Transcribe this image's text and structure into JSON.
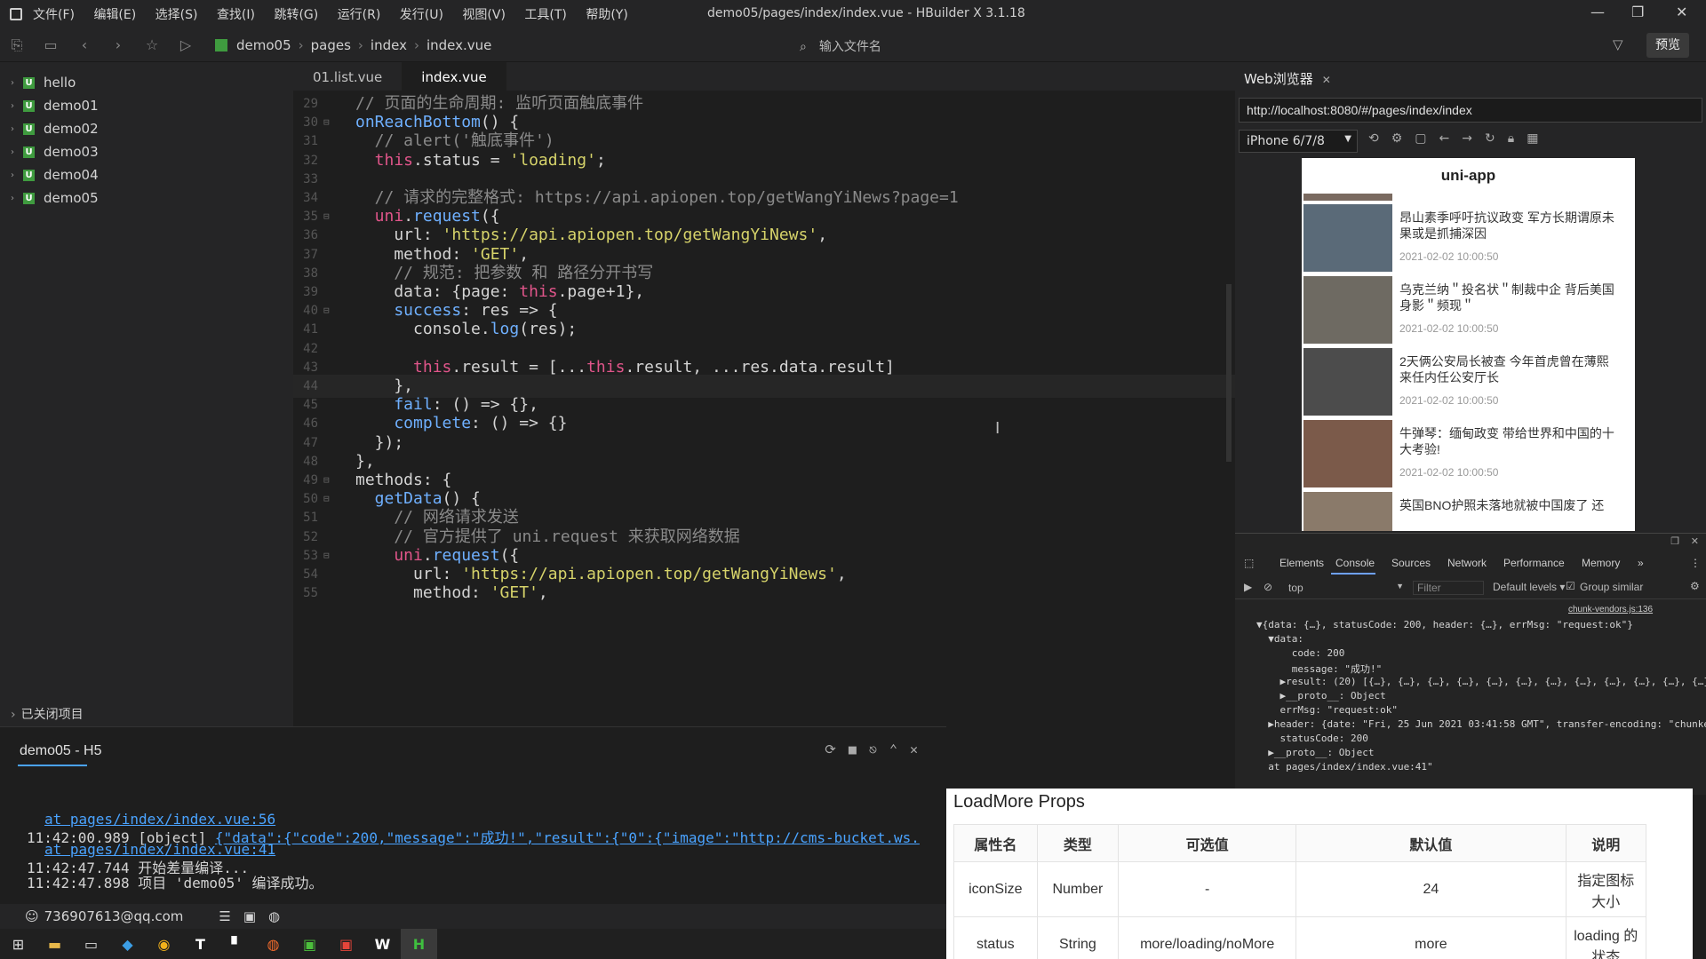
{
  "window": {
    "title": "demo05/pages/index/index.vue - HBuilder X 3.1.18",
    "menu": [
      "文件(F)",
      "编辑(E)",
      "选择(S)",
      "查找(I)",
      "跳转(G)",
      "运行(R)",
      "发行(U)",
      "视图(V)",
      "工具(T)",
      "帮助(Y)"
    ],
    "controls": {
      "minimize": "—",
      "maximize": "❐",
      "close": "✕"
    }
  },
  "toolbar": {
    "breadcrumb": [
      "demo05",
      "pages",
      "index",
      "index.vue"
    ],
    "search_placeholder": "输入文件名",
    "preview_label": "预览"
  },
  "sidebar": {
    "projects": [
      "hello",
      "demo01",
      "demo02",
      "demo03",
      "demo04",
      "demo05"
    ],
    "closed_projects_label": "已关闭项目"
  },
  "editor": {
    "tabs": [
      "01.list.vue",
      "index.vue"
    ],
    "active_tab": "index.vue",
    "lines": [
      {
        "n": "29",
        "fold": "",
        "parts": [
          [
            "cm",
            "// 页面的生命周期: 监听页面触底事件"
          ]
        ]
      },
      {
        "n": "30",
        "fold": "⊟",
        "parts": [
          [
            "fn",
            "onReachBottom"
          ],
          [
            "pl",
            "() {"
          ]
        ]
      },
      {
        "n": "31",
        "fold": "",
        "parts": [
          [
            "cm",
            "  // alert('触底事件')"
          ]
        ]
      },
      {
        "n": "32",
        "fold": "",
        "parts": [
          [
            "kw",
            "  this"
          ],
          [
            "pl",
            ".status = "
          ],
          [
            "st",
            "'loading'"
          ],
          [
            "pl",
            ";"
          ]
        ]
      },
      {
        "n": "33",
        "fold": "",
        "parts": [
          [
            "pl",
            ""
          ]
        ]
      },
      {
        "n": "34",
        "fold": "",
        "parts": [
          [
            "cm",
            "  // 请求的完整格式: https://api.apiopen.top/getWangYiNews?page=1"
          ]
        ]
      },
      {
        "n": "35",
        "fold": "⊟",
        "parts": [
          [
            "kw",
            "  uni"
          ],
          [
            "pl",
            "."
          ],
          [
            "fn",
            "request"
          ],
          [
            "pl",
            "({"
          ]
        ]
      },
      {
        "n": "36",
        "fold": "",
        "parts": [
          [
            "pl",
            "    url: "
          ],
          [
            "st",
            "'https://api.apiopen.top/getWangYiNews'"
          ],
          [
            "pl",
            ","
          ]
        ]
      },
      {
        "n": "37",
        "fold": "",
        "parts": [
          [
            "pl",
            "    method: "
          ],
          [
            "st",
            "'GET'"
          ],
          [
            "pl",
            ","
          ]
        ]
      },
      {
        "n": "38",
        "fold": "",
        "parts": [
          [
            "cm",
            "    // 规范: 把参数 和 路径分开书写"
          ]
        ]
      },
      {
        "n": "39",
        "fold": "",
        "parts": [
          [
            "pl",
            "    data: {page: "
          ],
          [
            "kw",
            "this"
          ],
          [
            "pl",
            ".page+1},"
          ]
        ]
      },
      {
        "n": "40",
        "fold": "⊟",
        "parts": [
          [
            "fn",
            "    success"
          ],
          [
            "pl",
            ": res => {"
          ]
        ]
      },
      {
        "n": "41",
        "fold": "",
        "parts": [
          [
            "pl",
            "      console."
          ],
          [
            "fn",
            "log"
          ],
          [
            "pl",
            "(res);"
          ]
        ]
      },
      {
        "n": "42",
        "fold": "",
        "parts": [
          [
            "pl",
            ""
          ]
        ]
      },
      {
        "n": "43",
        "fold": "",
        "parts": [
          [
            "kw",
            "      this"
          ],
          [
            "pl",
            ".result = [..."
          ],
          [
            "kw",
            "this"
          ],
          [
            "pl",
            ".result, ...res.data.result]"
          ]
        ]
      },
      {
        "n": "44",
        "fold": "",
        "parts": [
          [
            "pl",
            "    },"
          ]
        ]
      },
      {
        "n": "45",
        "fold": "",
        "parts": [
          [
            "fn",
            "    fail"
          ],
          [
            "pl",
            ": () => {},"
          ]
        ]
      },
      {
        "n": "46",
        "fold": "",
        "parts": [
          [
            "fn",
            "    complete"
          ],
          [
            "pl",
            ": () => {}"
          ]
        ]
      },
      {
        "n": "47",
        "fold": "",
        "parts": [
          [
            "pl",
            "  });"
          ]
        ]
      },
      {
        "n": "48",
        "fold": "",
        "parts": [
          [
            "pl",
            "},"
          ]
        ]
      },
      {
        "n": "49",
        "fold": "⊟",
        "parts": [
          [
            "pl",
            "methods: {"
          ]
        ]
      },
      {
        "n": "50",
        "fold": "⊟",
        "parts": [
          [
            "fn",
            "  getData"
          ],
          [
            "pl",
            "() {"
          ]
        ]
      },
      {
        "n": "51",
        "fold": "",
        "parts": [
          [
            "cm",
            "    // 网络请求发送"
          ]
        ]
      },
      {
        "n": "52",
        "fold": "",
        "parts": [
          [
            "cm",
            "    // 官方提供了 uni.request 来获取网络数据"
          ]
        ]
      },
      {
        "n": "53",
        "fold": "⊟",
        "parts": [
          [
            "kw",
            "    uni"
          ],
          [
            "pl",
            "."
          ],
          [
            "fn",
            "request"
          ],
          [
            "pl",
            "({"
          ]
        ]
      },
      {
        "n": "54",
        "fold": "",
        "parts": [
          [
            "pl",
            "      url: "
          ],
          [
            "st",
            "'https://api.apiopen.top/getWangYiNews'"
          ],
          [
            "pl",
            ","
          ]
        ]
      },
      {
        "n": "55",
        "fold": "",
        "parts": [
          [
            "pl",
            "      method: "
          ],
          [
            "st",
            "'GET'"
          ],
          [
            "pl",
            ","
          ]
        ]
      }
    ]
  },
  "console": {
    "title": "demo05 - H5",
    "lines": [
      {
        "prefix": "",
        "link": "at pages/index/index.vue:56",
        "rest": ""
      },
      {
        "prefix": "11:42:00.989 [object] ",
        "link": "{\"data\":{\"code\":200,\"message\":\"成功!\",\"result\":{\"0\":{\"image\":\"http://cms-bucket.ws.",
        "rest": ""
      },
      {
        "prefix": "",
        "link": "at pages/index/index.vue:41",
        "rest": ""
      },
      {
        "prefix": "11:42:47.744 开始差量编译...",
        "link": "",
        "rest": ""
      },
      {
        "prefix": "11:42:47.898 项目 'demo05' 编译成功。",
        "link": "",
        "rest": ""
      }
    ]
  },
  "statusbar": {
    "account": "736907613@qq.com"
  },
  "browser": {
    "tab_label": "Web浏览器",
    "url": "http://localhost:8080/#/pages/index/index",
    "device": "iPhone 6/7/8",
    "app_title": "uni-app",
    "news": [
      {
        "title": "昂山素季呼吁抗议政变 军方长期谓原未果或是抓捕深因",
        "date": "2021-02-02 10:00:50"
      },
      {
        "title": "乌克兰纳＂投名状＂制裁中企 背后美国身影＂频现＂",
        "date": "2021-02-02 10:00:50"
      },
      {
        "title": "2天俩公安局长被查 今年首虎曾在薄熙来任内任公安厅长",
        "date": "2021-02-02 10:00:50"
      },
      {
        "title": "牛弹琴：缅甸政变 带给世界和中国的十大考验!",
        "date": "2021-02-02 10:00:50"
      },
      {
        "title": "英国BNO护照未落地就被中国废了 还",
        "date": ""
      }
    ]
  },
  "devtools": {
    "tabs": [
      "Elements",
      "Console",
      "Sources",
      "Network",
      "Performance",
      "Memory",
      "»"
    ],
    "active_tab": "Console",
    "context": "top",
    "filter_placeholder": "Filter",
    "levels": "Default levels ▾",
    "group_similar": "Group similar",
    "source_link": "chunk-vendors.js:136",
    "lines": [
      "▼{data: {…}, statusCode: 200, header: {…}, errMsg: \"request:ok\"}",
      "  ▼data:",
      "      code: 200",
      "      message: \"成功!\"",
      "    ▶result: (20) [{…}, {…}, {…}, {…}, {…}, {…}, {…}, {…}, {…}, {…}, {…}, {…}",
      "    ▶__proto__: Object",
      "    errMsg: \"request:ok\"",
      "  ▶header: {date: \"Fri, 25 Jun 2021 03:41:58 GMT\", transfer-encoding: \"chunke",
      "    statusCode: 200",
      "  ▶__proto__: Object",
      "  at pages/index/index.vue:41\""
    ]
  },
  "props": {
    "title": "LoadMore Props",
    "headers": [
      "属性名",
      "类型",
      "可选值",
      "默认值",
      "说明"
    ],
    "rows": [
      [
        "iconSize",
        "Number",
        "-",
        "24",
        "指定图标大小"
      ],
      [
        "status",
        "String",
        "more/loading/noMore",
        "more",
        "loading 的状态"
      ]
    ]
  },
  "taskbar": {
    "items": [
      "windows-start",
      "file-explorer",
      "terminal",
      "vscode",
      "chrome",
      "typora",
      "bookmarks",
      "firefox",
      "camtasia",
      "recorder",
      "wps",
      "hbuilder"
    ]
  }
}
